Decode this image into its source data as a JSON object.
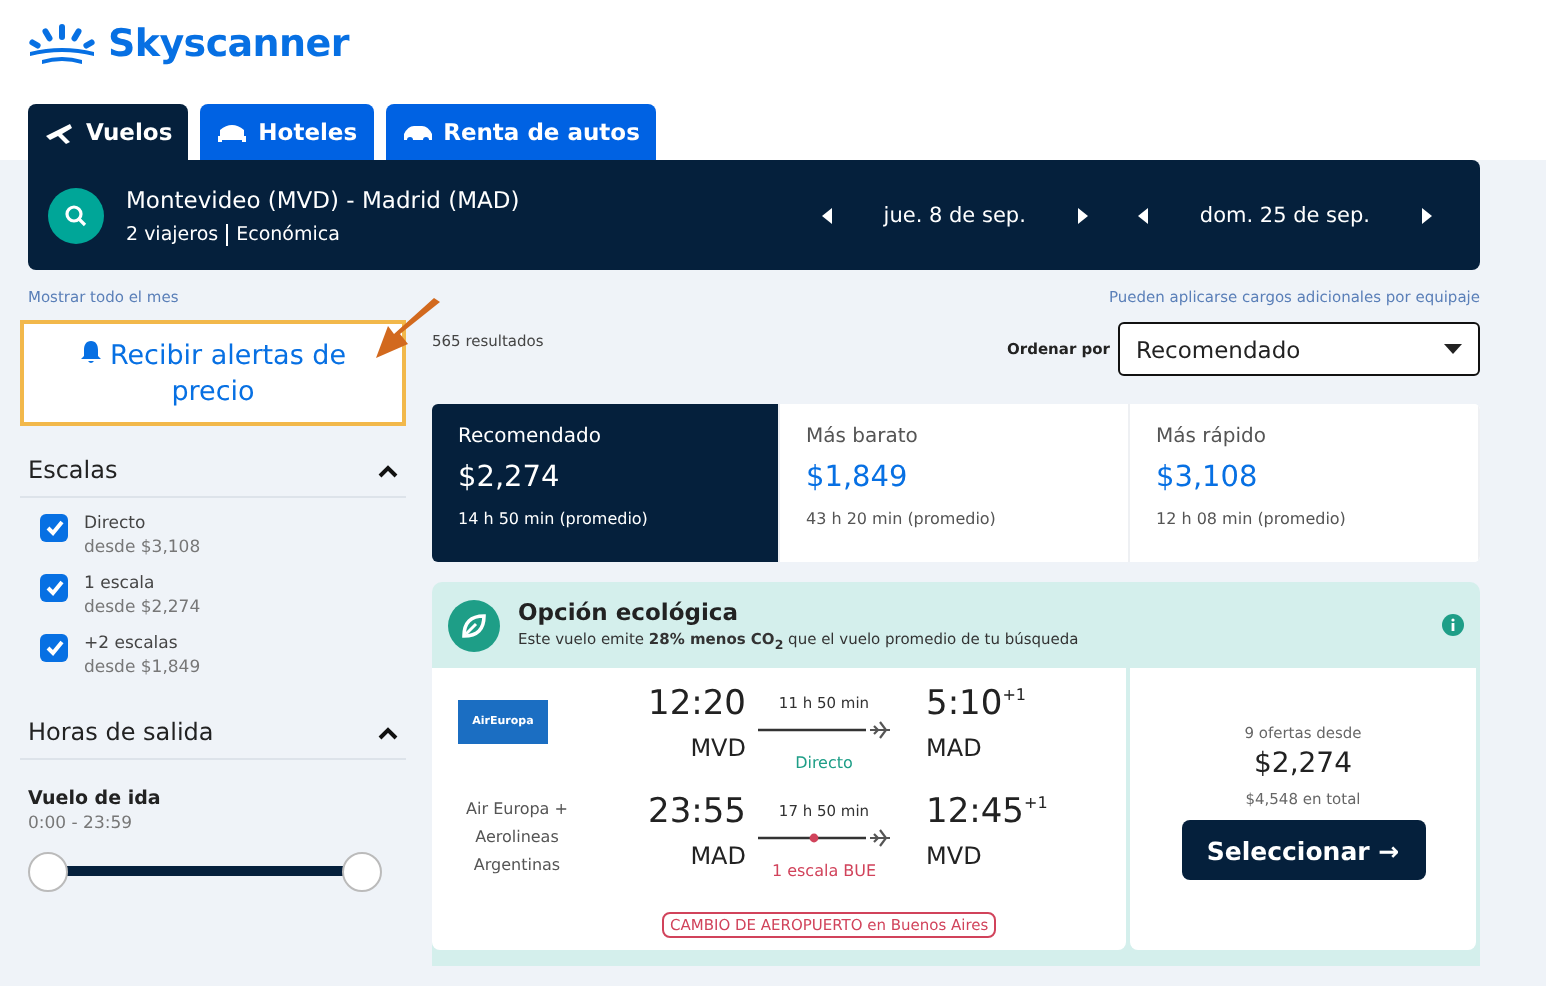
{
  "brand": {
    "name": "Skyscanner"
  },
  "tabs": [
    {
      "label": "Vuelos",
      "kind": "plane",
      "selected": true
    },
    {
      "label": "Hoteles",
      "kind": "bed",
      "selected": false
    },
    {
      "label": "Renta de autos",
      "kind": "car",
      "selected": false
    }
  ],
  "search": {
    "route": "Montevideo (MVD) - Madrid (MAD)",
    "travelers": "2 viajeros",
    "cabin": "Económica",
    "dates": [
      "jue. 8 de sep.",
      "dom. 25 de sep."
    ]
  },
  "links": {
    "month": "Mostrar todo el mes",
    "baggage": "Pueden aplicarse cargos adicionales por equipaje"
  },
  "alert_button": {
    "label": "Recibir alertas de precio",
    "highlighted": true
  },
  "filters": {
    "stops": {
      "title": "Escalas",
      "expanded": true,
      "options": [
        {
          "label": "Directo",
          "price": "desde $3,108",
          "checked": true
        },
        {
          "label": "1 escala",
          "price": "desde $2,274",
          "checked": true
        },
        {
          "label": "+2 escalas",
          "price": "desde $1,849",
          "checked": true
        }
      ]
    },
    "times": {
      "title": "Horas de salida",
      "expanded": true,
      "leg": "Vuelo de ida",
      "range": "0:00 - 23:59",
      "level": 1
    }
  },
  "results": {
    "count": "565 resultados",
    "sort_label": "Ordenar por",
    "sort_value": "Recomendado",
    "summary": [
      {
        "label": "Recomendado",
        "price": "$2,274",
        "duration": "14 h 50 min (promedio)",
        "selected": true
      },
      {
        "label": "Más barato",
        "price": "$1,849",
        "duration": "43 h 20 min (promedio)",
        "selected": false
      },
      {
        "label": "Más rápido",
        "price": "$3,108",
        "duration": "12 h 08 min (promedio)",
        "selected": false
      }
    ],
    "eco": {
      "title": "Opción ecológica",
      "text": "Este vuelo emite **28% menos CO$_{2}$** que el vuelo promedio de tu búsqueda"
    },
    "flight": {
      "legs": [
        {
          "airline": {
            "kind": "logo",
            "name": "AirEuropa"
          },
          "depart": "12:20",
          "from": "MVD",
          "duration": "11 h 50 min",
          "kind": "direct",
          "stops": "Directo",
          "arrive": "5:10$^{+1}$",
          "to": "MAD"
        },
        {
          "airline": {
            "kind": "text",
            "name": "Air Europa + Aerolineas Argentinas"
          },
          "depart": "23:55",
          "from": "MAD",
          "duration": "17 h 50 min",
          "kind": "stop",
          "stops": "1 escala BUE",
          "arrive": "12:45$^{+1}$",
          "to": "MVD",
          "warning": "CAMBIO DE AEROPUERTO en Buenos Aires"
        }
      ],
      "offers": "9 ofertas desde",
      "price": "$2,274",
      "total": "$4,548 en total",
      "button": "Seleccionar →"
    }
  }
}
